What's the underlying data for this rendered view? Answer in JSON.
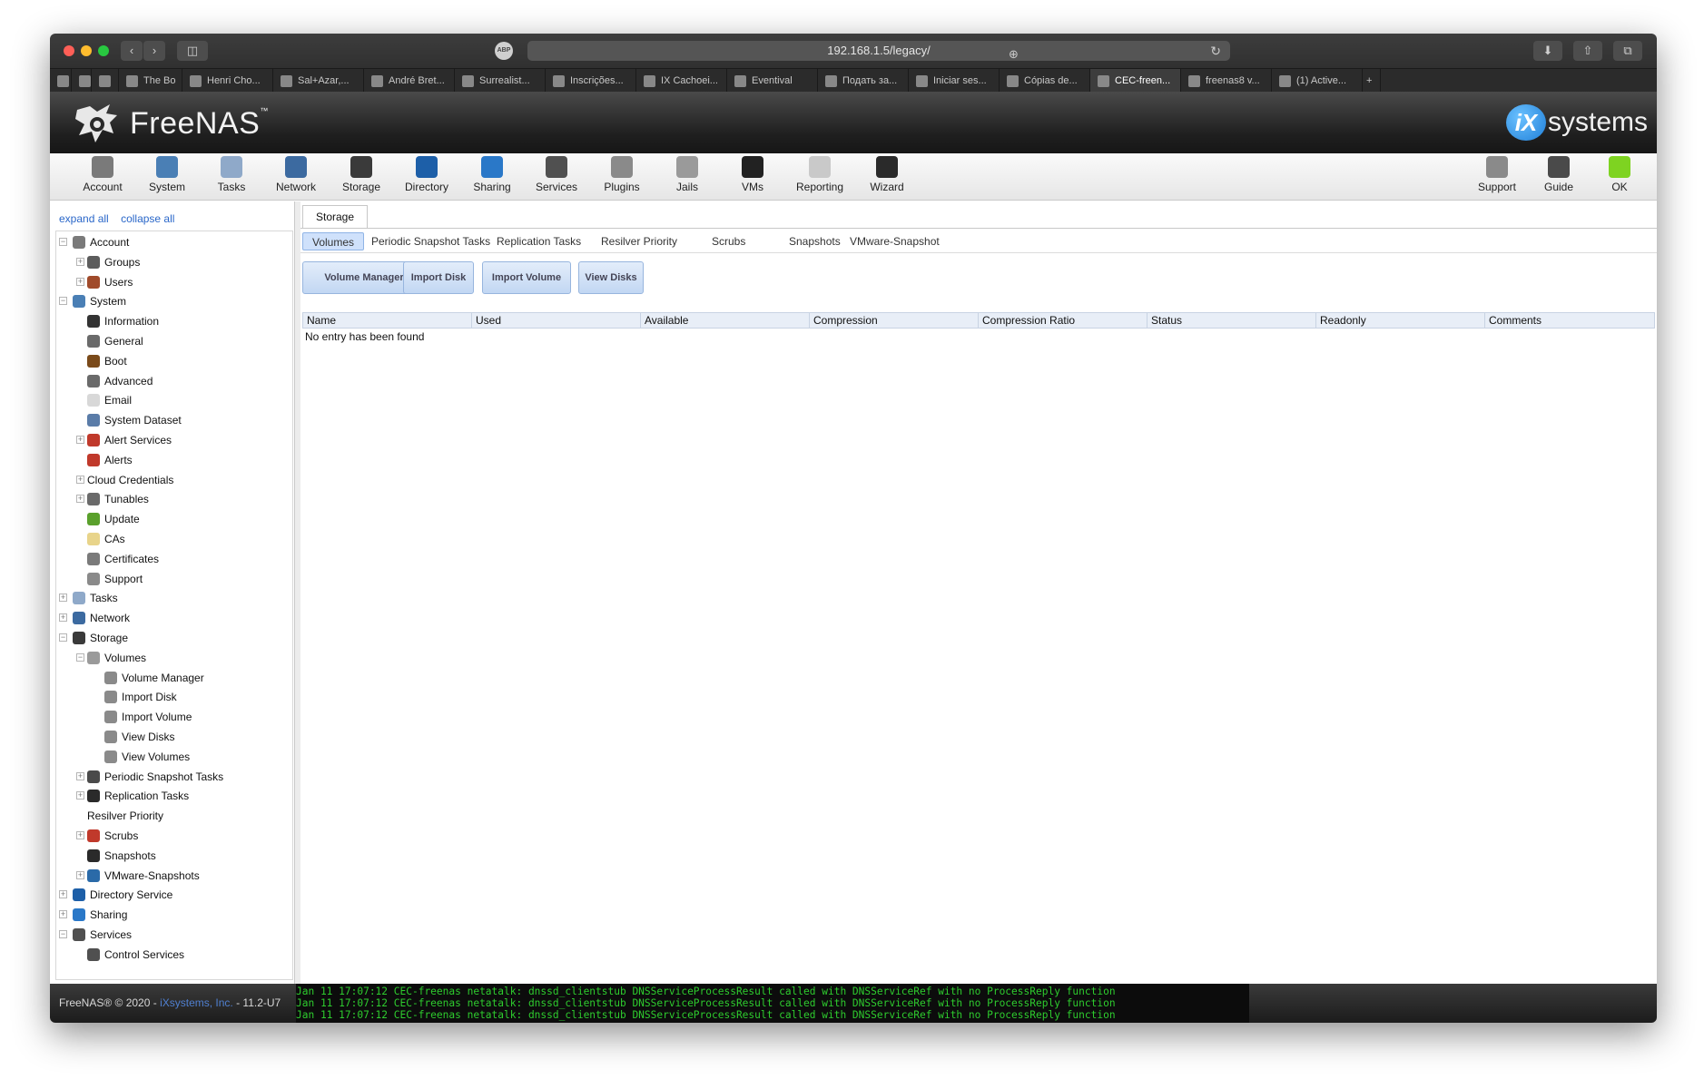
{
  "browser": {
    "url": "192.168.1.5/legacy/",
    "adblock_label": "ABP",
    "tabs": [
      {
        "label": "",
        "icon": "sheets-icon"
      },
      {
        "label": "",
        "icon": "blank-icon"
      },
      {
        "label": "",
        "icon": "cursor-icon"
      },
      {
        "label": "The Bo",
        "icon": "bo-icon"
      },
      {
        "label": "Henri Cho...",
        "icon": "art-icon"
      },
      {
        "label": "Sal+Azar,...",
        "icon": "wordpress-icon"
      },
      {
        "label": "André Bret...",
        "icon": "wikipedia-icon"
      },
      {
        "label": "Surrealist...",
        "icon": "wikipedia-icon"
      },
      {
        "label": "Inscrições...",
        "icon": "cb-icon"
      },
      {
        "label": "IX Cachoei...",
        "icon": "ix-icon"
      },
      {
        "label": "Eventival",
        "icon": "eventival-icon"
      },
      {
        "label": "Подать за...",
        "icon": "m-icon"
      },
      {
        "label": "Iniciar ses...",
        "icon": "paypal-icon"
      },
      {
        "label": "Cópias de...",
        "icon": "finder-icon"
      },
      {
        "label": "CEC-freen...",
        "icon": "freenas-icon"
      },
      {
        "label": "freenas8 v...",
        "icon": "google-icon"
      },
      {
        "label": "(1) Active...",
        "icon": "ix-systems-icon"
      }
    ]
  },
  "header": {
    "logo_text": "FreeNAS",
    "logo_tm": "™",
    "ix_badge": "iX",
    "ix_text": "systems"
  },
  "toolbar": {
    "left": [
      {
        "label": "Account",
        "icon": "account-icon",
        "color": "#7a7a7a"
      },
      {
        "label": "System",
        "icon": "system-icon",
        "color": "#4a7fb5"
      },
      {
        "label": "Tasks",
        "icon": "tasks-icon",
        "color": "#8fa9c9"
      },
      {
        "label": "Network",
        "icon": "network-icon",
        "color": "#3c6aa0"
      },
      {
        "label": "Storage",
        "icon": "storage-icon",
        "color": "#3a3a3a"
      },
      {
        "label": "Directory",
        "icon": "directory-icon",
        "color": "#1d5fa8"
      },
      {
        "label": "Sharing",
        "icon": "sharing-icon",
        "color": "#2a78c8"
      },
      {
        "label": "Services",
        "icon": "services-icon",
        "color": "#505050"
      },
      {
        "label": "Plugins",
        "icon": "plugins-icon",
        "color": "#8a8a8a"
      },
      {
        "label": "Jails",
        "icon": "jails-icon",
        "color": "#9a9a9a"
      },
      {
        "label": "VMs",
        "icon": "vms-icon",
        "color": "#222222"
      },
      {
        "label": "Reporting",
        "icon": "reporting-icon",
        "color": "#c9c9c9"
      },
      {
        "label": "Wizard",
        "icon": "wizard-icon",
        "color": "#2a2a2a"
      }
    ],
    "right": [
      {
        "label": "Support",
        "icon": "support-icon",
        "color": "#8a8a8a"
      },
      {
        "label": "Guide",
        "icon": "guide-icon",
        "color": "#4a4a4a"
      },
      {
        "label": "OK",
        "icon": "ok-icon",
        "color": "#7ed321"
      }
    ]
  },
  "left_panel": {
    "expand_all": "expand all",
    "collapse_all": "collapse all",
    "tree": [
      {
        "label": "Account",
        "level": 0,
        "toggle": "−",
        "icon": "account-icon",
        "color": "#7a7a7a"
      },
      {
        "label": "Groups",
        "level": 1,
        "toggle": "+",
        "icon": "groups-icon",
        "color": "#5c5c5c"
      },
      {
        "label": "Users",
        "level": 1,
        "toggle": "+",
        "icon": "users-icon",
        "color": "#a04a2a"
      },
      {
        "label": "System",
        "level": 0,
        "toggle": "−",
        "icon": "system-icon",
        "color": "#4a7fb5"
      },
      {
        "label": "Information",
        "level": 1,
        "toggle": "",
        "icon": "info-icon",
        "color": "#333333"
      },
      {
        "label": "General",
        "level": 1,
        "toggle": "",
        "icon": "wrench-icon",
        "color": "#6a6a6a"
      },
      {
        "label": "Boot",
        "level": 1,
        "toggle": "",
        "icon": "boot-icon",
        "color": "#7a4a1a"
      },
      {
        "label": "Advanced",
        "level": 1,
        "toggle": "",
        "icon": "wrench-icon",
        "color": "#6a6a6a"
      },
      {
        "label": "Email",
        "level": 1,
        "toggle": "",
        "icon": "email-icon",
        "color": "#d8d8d8"
      },
      {
        "label": "System Dataset",
        "level": 1,
        "toggle": "",
        "icon": "dataset-icon",
        "color": "#5a7ca8"
      },
      {
        "label": "Alert Services",
        "level": 1,
        "toggle": "+",
        "icon": "alert-icon",
        "color": "#c0392b"
      },
      {
        "label": "Alerts",
        "level": 1,
        "toggle": "",
        "icon": "alert-icon",
        "color": "#c0392b"
      },
      {
        "label": "Cloud Credentials",
        "level": 1,
        "toggle": "+",
        "icon": "",
        "color": ""
      },
      {
        "label": "Tunables",
        "level": 1,
        "toggle": "+",
        "icon": "tunables-icon",
        "color": "#6a6a6a"
      },
      {
        "label": "Update",
        "level": 1,
        "toggle": "",
        "icon": "update-icon",
        "color": "#5aa02c"
      },
      {
        "label": "CAs",
        "level": 1,
        "toggle": "",
        "icon": "ca-icon",
        "color": "#e8d48a"
      },
      {
        "label": "Certificates",
        "level": 1,
        "toggle": "",
        "icon": "certificate-icon",
        "color": "#7a7a7a"
      },
      {
        "label": "Support",
        "level": 1,
        "toggle": "",
        "icon": "support-icon",
        "color": "#8a8a8a"
      },
      {
        "label": "Tasks",
        "level": 0,
        "toggle": "+",
        "icon": "tasks-icon",
        "color": "#8fa9c9"
      },
      {
        "label": "Network",
        "level": 0,
        "toggle": "+",
        "icon": "network-icon",
        "color": "#3c6aa0"
      },
      {
        "label": "Storage",
        "level": 0,
        "toggle": "−",
        "icon": "storage-icon",
        "color": "#3a3a3a"
      },
      {
        "label": "Volumes",
        "level": 1,
        "toggle": "−",
        "icon": "volumes-icon",
        "color": "#9a9a9a"
      },
      {
        "label": "Volume Manager",
        "level": 2,
        "toggle": "",
        "icon": "volume-manager-icon",
        "color": "#8a8a8a"
      },
      {
        "label": "Import Disk",
        "level": 2,
        "toggle": "",
        "icon": "import-disk-icon",
        "color": "#8a8a8a"
      },
      {
        "label": "Import Volume",
        "level": 2,
        "toggle": "",
        "icon": "import-volume-icon",
        "color": "#8a8a8a"
      },
      {
        "label": "View Disks",
        "level": 2,
        "toggle": "",
        "icon": "view-disks-icon",
        "color": "#8a8a8a"
      },
      {
        "label": "View Volumes",
        "level": 2,
        "toggle": "",
        "icon": "view-volumes-icon",
        "color": "#8a8a8a"
      },
      {
        "label": "Periodic Snapshot Tasks",
        "level": 1,
        "toggle": "+",
        "icon": "snapshot-icon",
        "color": "#4a4a4a"
      },
      {
        "label": "Replication Tasks",
        "level": 1,
        "toggle": "+",
        "icon": "replication-icon",
        "color": "#2a2a2a"
      },
      {
        "label": "Resilver Priority",
        "level": 1,
        "toggle": "",
        "icon": "",
        "color": ""
      },
      {
        "label": "Scrubs",
        "level": 1,
        "toggle": "+",
        "icon": "scrubs-icon",
        "color": "#c0392b"
      },
      {
        "label": "Snapshots",
        "level": 1,
        "toggle": "",
        "icon": "snapshots-icon",
        "color": "#2a2a2a"
      },
      {
        "label": "VMware-Snapshots",
        "level": 1,
        "toggle": "+",
        "icon": "vmware-icon",
        "color": "#2a6aa8"
      },
      {
        "label": "Directory Service",
        "level": 0,
        "toggle": "+",
        "icon": "directory-icon",
        "color": "#1d5fa8"
      },
      {
        "label": "Sharing",
        "level": 0,
        "toggle": "+",
        "icon": "sharing-icon",
        "color": "#2a78c8"
      },
      {
        "label": "Services",
        "level": 0,
        "toggle": "−",
        "icon": "services-icon",
        "color": "#505050"
      },
      {
        "label": "Control Services",
        "level": 1,
        "toggle": "",
        "icon": "services-icon",
        "color": "#505050"
      }
    ]
  },
  "content": {
    "main_tab": "Storage",
    "subtabs": [
      "Volumes",
      "Periodic Snapshot Tasks",
      "Replication Tasks",
      "Resilver Priority",
      "Scrubs",
      "Snapshots",
      "VMware-Snapshot"
    ],
    "buttons": [
      "Volume Manager",
      "Import Disk",
      "Import Volume",
      "View Disks"
    ],
    "columns": [
      "Name",
      "Used",
      "Available",
      "Compression",
      "Compression Ratio",
      "Status",
      "Readonly",
      "Comments"
    ],
    "empty_message": "No entry has been found"
  },
  "footer": {
    "copyright": "FreeNAS® © 2020 - ",
    "company": "iXsystems, Inc.",
    "version": " - 11.2-U7",
    "console_lines": [
      "Jan 11 17:07:12 CEC-freenas netatalk: dnssd_clientstub DNSServiceProcessResult called with DNSServiceRef with no ProcessReply function",
      "Jan 11 17:07:12 CEC-freenas netatalk: dnssd_clientstub DNSServiceProcessResult called with DNSServiceRef with no ProcessReply function",
      "Jan 11 17:07:12 CEC-freenas netatalk: dnssd_clientstub DNSServiceProcessResult called with DNSServiceRef with no ProcessReply function"
    ]
  },
  "colors": {
    "accent": "#2a67c9",
    "console_text": "#2ecc2e",
    "selected_subtab": "#cfe1fb"
  }
}
